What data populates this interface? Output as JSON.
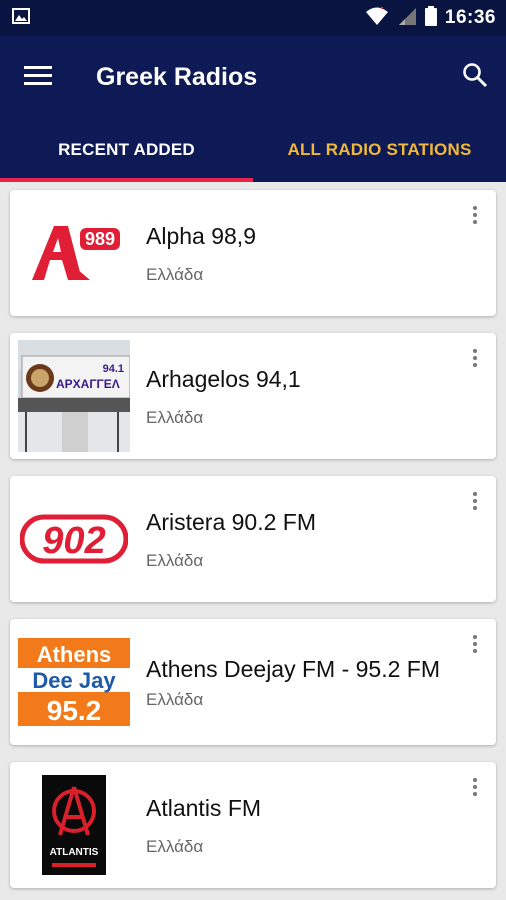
{
  "status": {
    "time": "16:36"
  },
  "appbar": {
    "title": "Greek Radios"
  },
  "tabs": [
    {
      "label": "RECENT ADDED",
      "active": true
    },
    {
      "label": "ALL RADIO STATIONS",
      "active": false
    }
  ],
  "stations": [
    {
      "name": "Alpha 98,9",
      "country": "Ελλάδα",
      "logo_text": "989"
    },
    {
      "name": "Arhagelos 94,1",
      "country": "Ελλάδα",
      "logo_text": "94.1",
      "logo_subtext": "ΑΡΧΑΓΓΕΛ"
    },
    {
      "name": "Aristera 90.2 FM",
      "country": "Ελλάδα",
      "logo_text": "902"
    },
    {
      "name": "Athens Deejay FM - 95.2 FM",
      "country": "Ελλάδα",
      "logo_lines": [
        "Athens",
        "Dee Jay",
        "95.2"
      ]
    },
    {
      "name": "Atlantis FM",
      "country": "Ελλάδα",
      "logo_text": "ATLANTIS"
    }
  ],
  "colors": {
    "appbar": "#0d1a55",
    "tab_inactive": "#f2b83a",
    "indicator": "#e8234a"
  }
}
